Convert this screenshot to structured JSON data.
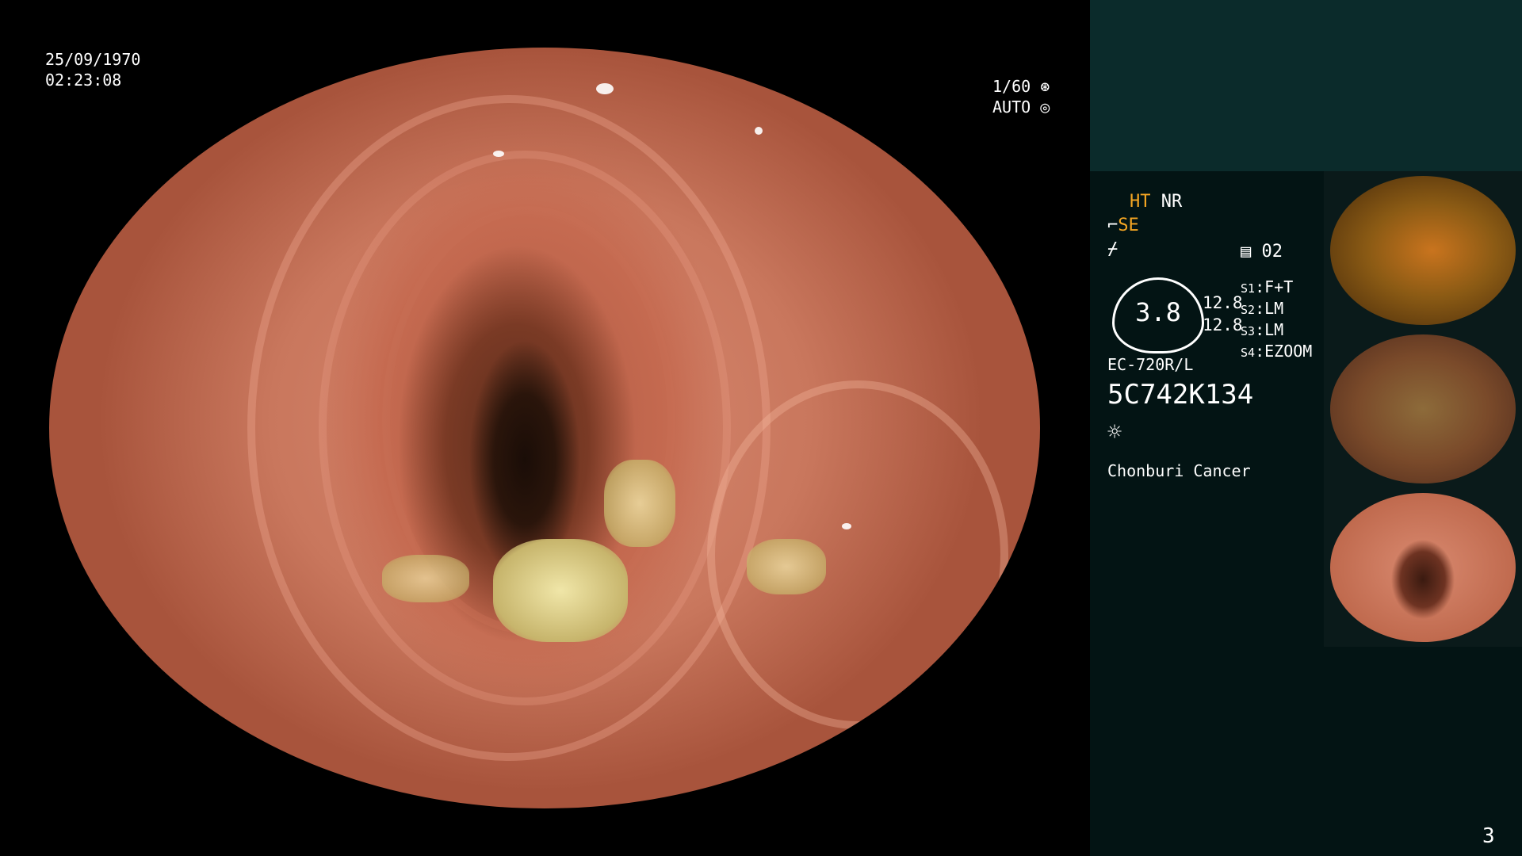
{
  "overlay": {
    "date": "25/09/1970",
    "time": "02:23:08",
    "shutter": "1/60",
    "iris": "AUTO"
  },
  "panel": {
    "mode_ht": "HT",
    "mode_nr": "NR",
    "mode_se": "SE",
    "mem_label": "02",
    "gauge_value": "3.8",
    "val_top": "12.8",
    "val_bottom": "12.8",
    "settings": [
      {
        "key": "S1",
        "value": "F+T"
      },
      {
        "key": "S2",
        "value": "LM"
      },
      {
        "key": "S3",
        "value": "LM"
      },
      {
        "key": "S4",
        "value": "EZOOM"
      }
    ],
    "scope_model": "EC-720R/L",
    "serial": "5C742K134",
    "facility": "Chonburi Cancer",
    "page_number": "3"
  },
  "colors": {
    "panel_bg": "#031414",
    "panel_top": "#0b2b2b",
    "accent": "#f5a623"
  }
}
